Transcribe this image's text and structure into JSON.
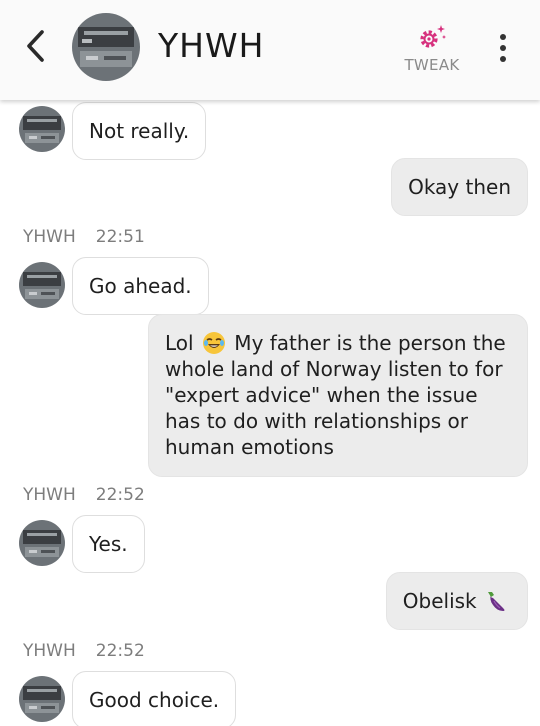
{
  "header": {
    "title": "YHWH",
    "tweak_label": "TWEAK",
    "accent_color": "#d6307d"
  },
  "messages": [
    {
      "direction": "incoming",
      "text": "Not really."
    },
    {
      "direction": "outgoing",
      "text": "Okay then"
    },
    {
      "direction": "meta",
      "sender": "YHWH",
      "time": "22:51"
    },
    {
      "direction": "incoming",
      "text": "Go ahead."
    },
    {
      "direction": "outgoing",
      "text_before_emoji": "Lol",
      "emoji": "laughing-face-emoji",
      "text_after_emoji": " My father is the person the whole land of Norway listen to for \"expert advice\" when the issue has to do with relationships or human emotions"
    },
    {
      "direction": "meta",
      "sender": "YHWH",
      "time": "22:52"
    },
    {
      "direction": "incoming",
      "text": "Yes."
    },
    {
      "direction": "outgoing",
      "text": "Obelisk",
      "emoji": "eggplant-emoji"
    },
    {
      "direction": "meta",
      "sender": "YHWH",
      "time": "22:52"
    },
    {
      "direction": "incoming",
      "text": "Good choice."
    }
  ]
}
